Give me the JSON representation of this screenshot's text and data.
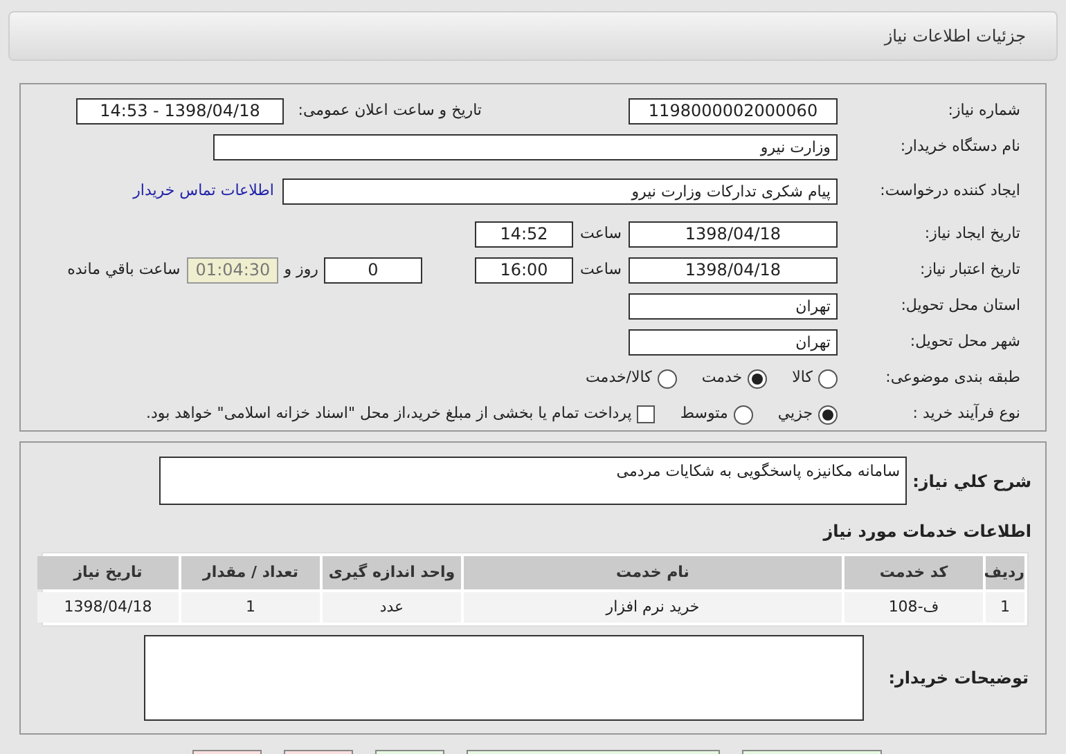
{
  "header": {
    "title": "جزئیات اطلاعات نیاز"
  },
  "details": {
    "need_number": {
      "label": "شماره نیاز:",
      "value": "1198000002000060"
    },
    "announce": {
      "label": "تاریخ و ساعت اعلان عمومی:",
      "value": "1398/04/18 - 14:53"
    },
    "buyer_org": {
      "label": "نام دستگاه خریدار:",
      "value": "وزارت نیرو"
    },
    "creator": {
      "label": "ایجاد کننده درخواست:",
      "value": "پیام شکری تدارکات وزارت نیرو",
      "link": "اطلاعات تماس خریدار"
    },
    "created": {
      "label": "تاریخ ایجاد نیاز:",
      "date": "1398/04/18",
      "time_label": "ساعت",
      "time": "14:52"
    },
    "valid": {
      "label": "تاریخ اعتبار نیاز:",
      "date": "1398/04/18",
      "time_label": "ساعت",
      "time": "16:00",
      "days": "0",
      "days_label": "روز و",
      "remaining": "01:04:30",
      "remaining_label": "ساعت باقي مانده"
    },
    "province": {
      "label": "استان محل تحویل:",
      "value": "تهران"
    },
    "city": {
      "label": "شهر محل تحویل:",
      "value": "تهران"
    },
    "category": {
      "label": "طبقه بندی موضوعی:",
      "options": [
        {
          "label": "کالا",
          "selected": false
        },
        {
          "label": "خدمت",
          "selected": true
        },
        {
          "label": "کالا/خدمت",
          "selected": false
        }
      ]
    },
    "process": {
      "label": "نوع فرآیند خرید :",
      "options": [
        {
          "label": "جزيي",
          "selected": true
        },
        {
          "label": "متوسط",
          "selected": false
        }
      ],
      "treasury": {
        "label": "پرداخت تمام یا بخشی از مبلغ خرید،از محل \"اسناد خزانه اسلامی\" خواهد بود.",
        "checked": false
      }
    }
  },
  "summary": {
    "label": "شرح کلي نیاز:",
    "value": "سامانه مکانیزه پاسخگویی به شکایات مردمی"
  },
  "services": {
    "title": "اطلاعات خدمات مورد نیاز",
    "columns": [
      "ردیف",
      "کد خدمت",
      "نام خدمت",
      "واحد اندازه گیری",
      "تعداد / مقدار",
      "تاریخ نیاز"
    ],
    "rows": [
      [
        "1",
        "ف-108",
        "خرید نرم افزار",
        "عدد",
        "1",
        "1398/04/18"
      ]
    ]
  },
  "notes": {
    "label": "توضیحات خریدار:"
  },
  "bottom_buttons": [
    {
      "color": "#fbe0e0"
    },
    {
      "color": "#fbe0e0"
    },
    {
      "color": "#e6f7e2"
    },
    {
      "color": "#e6f7e2"
    },
    {
      "color": "#e6f7e2"
    }
  ]
}
